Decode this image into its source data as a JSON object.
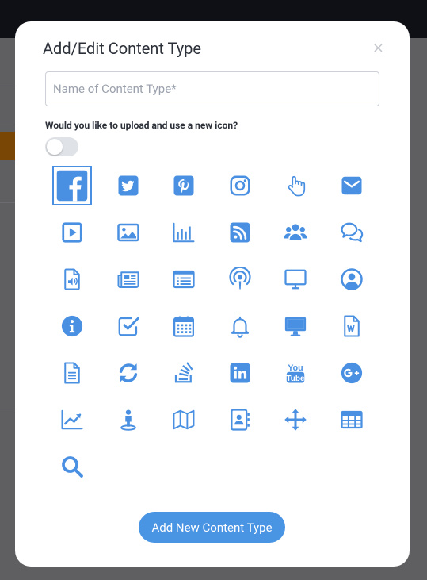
{
  "modal": {
    "title": "Add/Edit Content Type",
    "close_label": "×",
    "name_placeholder": "Name of Content Type*",
    "name_value": "",
    "upload_question": "Would you like to upload and use a new icon?",
    "upload_toggle_on": false,
    "submit_label": "Add New Content Type",
    "accent_color": "#4a90e2",
    "selected_icon": "facebook"
  },
  "icons": [
    "facebook",
    "twitter",
    "pinterest",
    "instagram",
    "hand-pointer",
    "envelope",
    "video-play",
    "image",
    "bar-chart",
    "rss",
    "users",
    "comments",
    "audio-file",
    "newspaper",
    "list-card",
    "podcast",
    "monitor",
    "user-circle",
    "info-circle",
    "check-square",
    "calendar",
    "bell",
    "desktop",
    "word-file",
    "text-file",
    "refresh",
    "stack-overflow",
    "linkedin",
    "youtube",
    "google-plus",
    "line-chart",
    "street-view",
    "map",
    "address-book",
    "move-arrows",
    "table",
    "search"
  ]
}
